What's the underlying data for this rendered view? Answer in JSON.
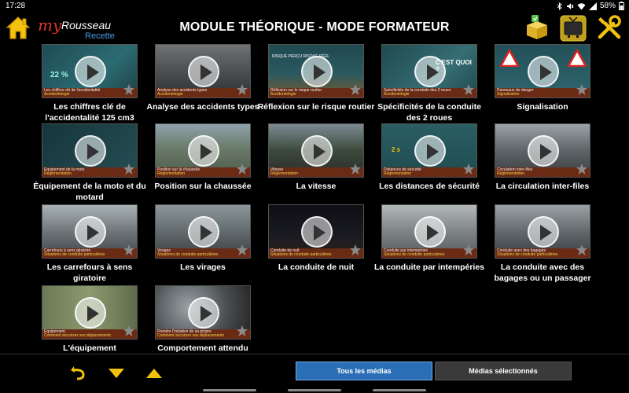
{
  "status": {
    "time": "17:28",
    "battery": "58%"
  },
  "header": {
    "title": "MODULE THÉORIQUE - MODE FORMATEUR",
    "logo_my": "my",
    "logo_brand": "Rousseau",
    "logo_env": "Recette"
  },
  "tiles": [
    {
      "label": "Les chiffres clé de l'accidentalité 125 cm3",
      "thumb_title": "Les chiffres clé de l'accidentalité",
      "thumb_sub": "Accidentologie",
      "thumb_text": "22 %"
    },
    {
      "label": "Analyse des accidents types",
      "thumb_title": "Analyse des accidents types",
      "thumb_sub": "Accidentologie",
      "thumb_text": ""
    },
    {
      "label": "Réflexion sur le risque routier",
      "thumb_title": "Réflexion sur le risque routier",
      "thumb_sub": "Accidentologie",
      "thumb_text": "RISQUE PERÇU    RISQUE RÉEL"
    },
    {
      "label": "Spécificités de la conduite des 2 roues",
      "thumb_title": "Spécificités de la conduite des 2 roues",
      "thumb_sub": "Accidentologie",
      "thumb_text": "C'EST QUOI ?"
    },
    {
      "label": "Signalisation",
      "thumb_title": "Panneaux de danger",
      "thumb_sub": "Signalisation",
      "thumb_text": ""
    },
    {
      "label": "Équipement de la moto et du motard",
      "thumb_title": "Équipement de la moto",
      "thumb_sub": "Réglementation",
      "thumb_text": ""
    },
    {
      "label": "Position sur la chaussée",
      "thumb_title": "Position sur la chaussée",
      "thumb_sub": "Réglementation",
      "thumb_text": ""
    },
    {
      "label": "La vitesse",
      "thumb_title": "Vitesse",
      "thumb_sub": "Réglementation",
      "thumb_text": ""
    },
    {
      "label": "Les distances de sécurité",
      "thumb_title": "Distances de sécurité",
      "thumb_sub": "Réglementation",
      "thumb_text": "2 s"
    },
    {
      "label": "La circulation inter-files",
      "thumb_title": "Circulation inter-files",
      "thumb_sub": "Réglementation",
      "thumb_text": ""
    },
    {
      "label": "Les carrefours à sens giratoire",
      "thumb_title": "Carrefours à sens giratoire",
      "thumb_sub": "Situations de conduite particulières",
      "thumb_text": ""
    },
    {
      "label": "Les virages",
      "thumb_title": "Virages",
      "thumb_sub": "Situations de conduite particulières",
      "thumb_text": ""
    },
    {
      "label": "La conduite de nuit",
      "thumb_title": "Conduite de nuit",
      "thumb_sub": "Situations de conduite particulières",
      "thumb_text": ""
    },
    {
      "label": "La conduite par intempéries",
      "thumb_title": "Conduite par intempéries",
      "thumb_sub": "Situations de conduite particulières",
      "thumb_text": ""
    },
    {
      "label": "La conduite avec des bagages ou un passager",
      "thumb_title": "Conduite avec des bagages",
      "thumb_sub": "Situations de conduite particulières",
      "thumb_text": ""
    },
    {
      "label": "L'équipement",
      "thumb_title": "Équipement",
      "thumb_sub": "Comment sécuriser ses déplacements",
      "thumb_text": ""
    },
    {
      "label": "Comportement attendu",
      "thumb_title": "Prendre l'initiative de sa propre",
      "thumb_sub": "Comment sécuriser ses déplacements",
      "thumb_text": ""
    }
  ],
  "footer": {
    "all_media": "Tous les médias",
    "selected_media": "Médias sélectionnés"
  },
  "colors": {
    "accent_blue": "#2a6fb5",
    "arrow_yellow": "#f2c20c",
    "label_bar": "#6b2a14"
  }
}
